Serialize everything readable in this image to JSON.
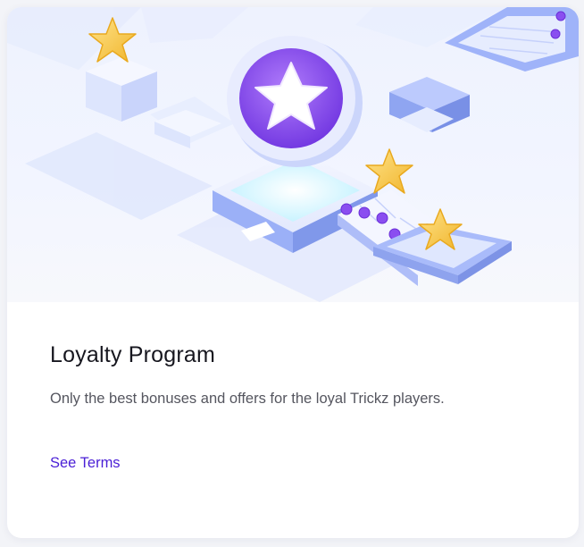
{
  "card": {
    "title": "Loyalty Program",
    "description": "Only the best bonuses and offers for the loyal Trickz players.",
    "terms_link": "See Terms"
  },
  "illustration": {
    "subject": "isometric loyalty platform with coin and stars",
    "icons": [
      "star-coin-icon",
      "star-icon"
    ]
  },
  "colors": {
    "title_text": "#17171f",
    "body_text": "#55565f",
    "link": "#4a1fd6",
    "accent_purple": "#8e55f0",
    "star_gold": "#f6c945"
  }
}
